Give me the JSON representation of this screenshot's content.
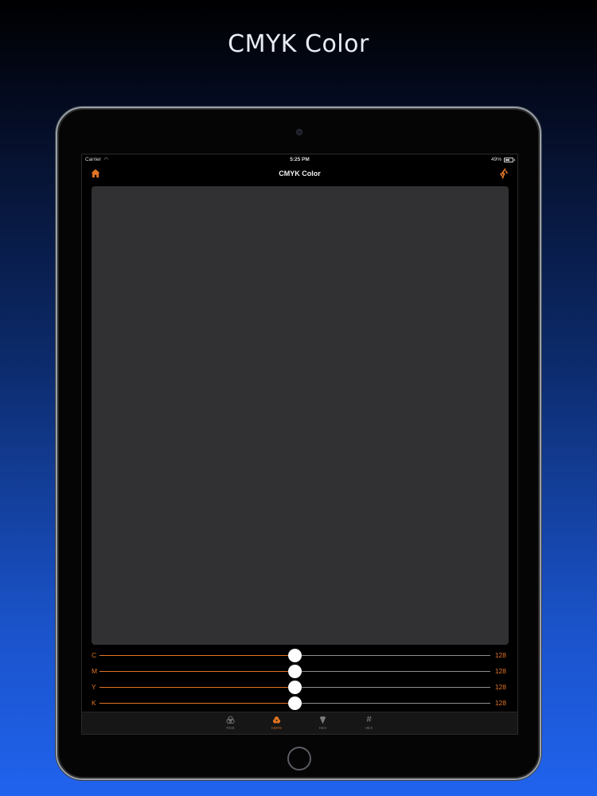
{
  "promo": {
    "title": "CMYK Color"
  },
  "status_bar": {
    "carrier": "Carrier",
    "time": "5:25 PM",
    "battery": "49%"
  },
  "nav": {
    "title": "CMYK Color",
    "left_icon": "home-icon",
    "right_icon": "refresh-icon"
  },
  "preview": {
    "color": "#313033"
  },
  "sliders": [
    {
      "label": "C",
      "value": "128",
      "fraction": 0.5
    },
    {
      "label": "M",
      "value": "128",
      "fraction": 0.5
    },
    {
      "label": "Y",
      "value": "128",
      "fraction": 0.5
    },
    {
      "label": "K",
      "value": "128",
      "fraction": 0.5
    }
  ],
  "tabs": [
    {
      "label": "RGB",
      "icon": "rgb-circles-icon",
      "active": false
    },
    {
      "label": "CMYK",
      "icon": "cmyk-circles-icon",
      "active": true
    },
    {
      "label": "HSV",
      "icon": "hsv-cone-icon",
      "active": false
    },
    {
      "label": "HEX",
      "icon": "hash-icon",
      "active": false
    }
  ],
  "colors": {
    "accent": "#E07424",
    "inactive": "#7A7A7A",
    "background": "#000000"
  }
}
